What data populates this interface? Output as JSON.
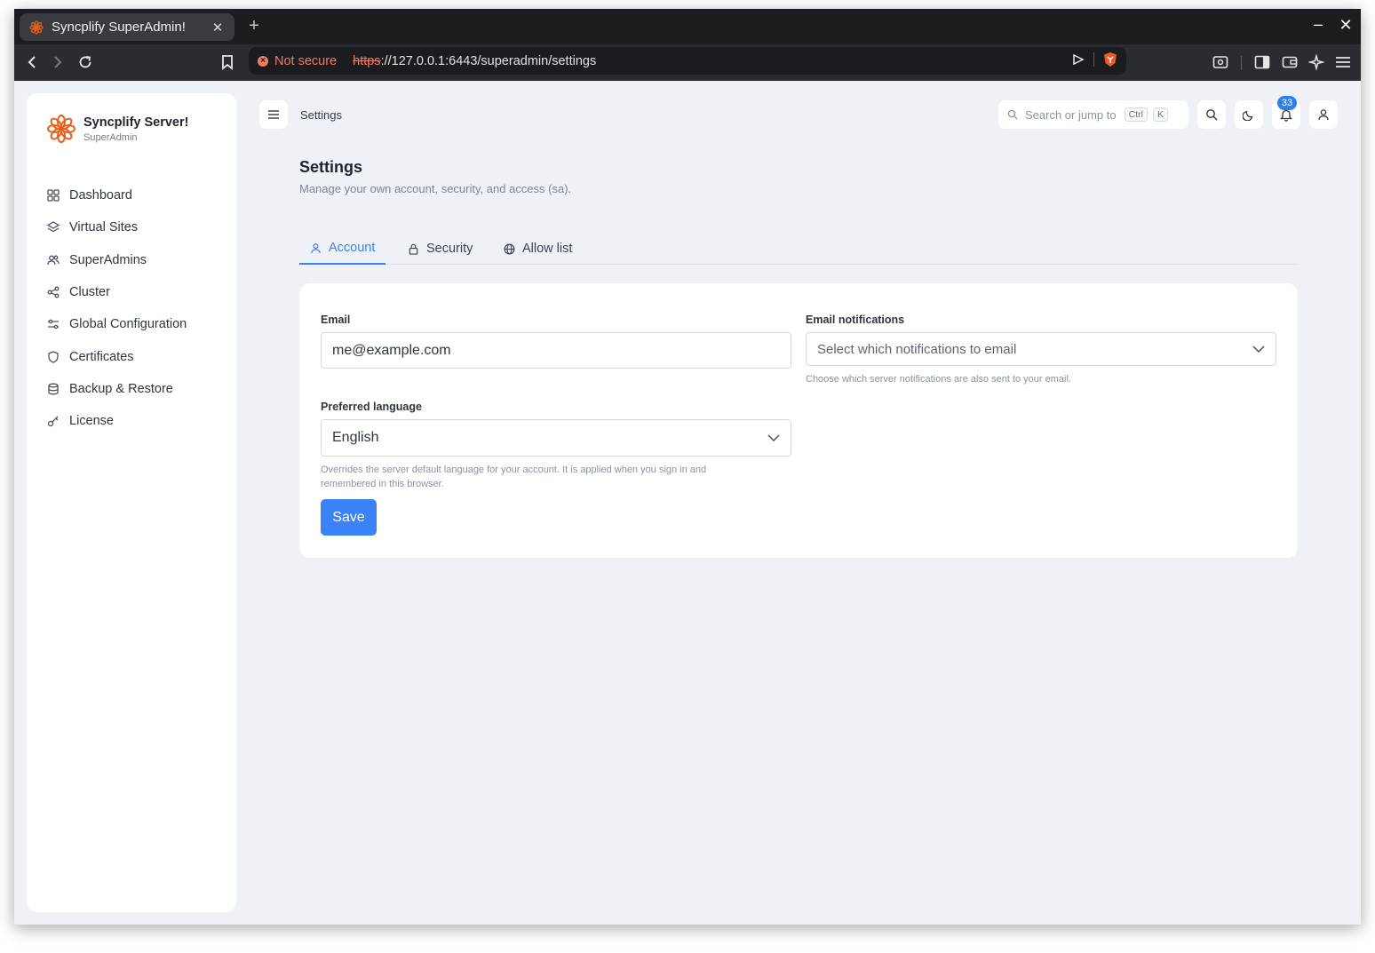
{
  "browser": {
    "tab_title": "Syncplify SuperAdmin!",
    "tab_close": "✕",
    "new_tab": "+",
    "window_minimize": "–",
    "window_close": "✕",
    "security_label": "Not secure",
    "url_scheme": "https",
    "url_rest": "://127.0.0.1:6443/superadmin/settings"
  },
  "sidebar": {
    "brand_name": "Syncplify Server!",
    "brand_sub": "SuperAdmin",
    "items": [
      {
        "label": "Dashboard",
        "icon": "grid-icon"
      },
      {
        "label": "Virtual Sites",
        "icon": "layers-icon"
      },
      {
        "label": "SuperAdmins",
        "icon": "users-icon"
      },
      {
        "label": "Cluster",
        "icon": "share-icon"
      },
      {
        "label": "Global Configuration",
        "icon": "sliders-icon"
      },
      {
        "label": "Certificates",
        "icon": "shield-icon"
      },
      {
        "label": "Backup & Restore",
        "icon": "database-icon"
      },
      {
        "label": "License",
        "icon": "key-icon"
      }
    ]
  },
  "topbar": {
    "breadcrumb": "Settings",
    "search_placeholder": "Search or jump to",
    "kbd_ctrl": "Ctrl",
    "kbd_k": "K",
    "notification_count": "33"
  },
  "page": {
    "title": "Settings",
    "subtitle": "Manage your own account, security, and access (sa).",
    "tabs": [
      {
        "label": "Account",
        "active": true,
        "icon": "user-icon"
      },
      {
        "label": "Security",
        "active": false,
        "icon": "lock-icon"
      },
      {
        "label": "Allow list",
        "active": false,
        "icon": "globe-icon"
      }
    ]
  },
  "form": {
    "email_label": "Email",
    "email_value": "me@example.com",
    "notifications_label": "Email notifications",
    "notifications_placeholder": "Select which notifications to email",
    "notifications_help": "Choose which server notifications are also sent to your email.",
    "language_label": "Preferred language",
    "language_value": "English",
    "language_help_line1": "Overrides the server default language for your account. It is applied when you sign in and",
    "language_help_line2": "remembered in this browser.",
    "save_label": "Save"
  },
  "colors": {
    "accent": "#3b82f6",
    "brand_orange": "#e8601c",
    "warning": "#f07b67",
    "background": "#eef2f7"
  }
}
